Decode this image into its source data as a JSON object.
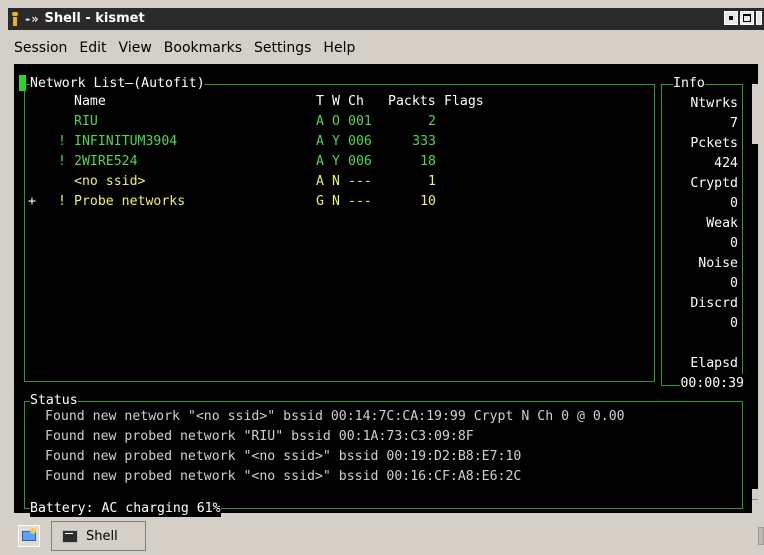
{
  "window": {
    "title": "Shell - kismet",
    "title_glyph": "-»"
  },
  "menu": [
    "Session",
    "Edit",
    "View",
    "Bookmarks",
    "Settings",
    "Help"
  ],
  "network_list": {
    "title": "Network List—(Autofit)",
    "headers": {
      "name": "Name",
      "t": "T",
      "w": "W",
      "ch": "Ch",
      "packts": "Packts",
      "flags": "Flags"
    },
    "rows": [
      {
        "marker": "",
        "bang": "",
        "name": "RIU",
        "t": "A",
        "w": "O",
        "ch": "001",
        "packts": "2",
        "color": "#4fd64f"
      },
      {
        "marker": "",
        "bang": "!",
        "name": "INFINITUM3904",
        "t": "A",
        "w": "Y",
        "ch": "006",
        "packts": "333",
        "color": "#4fd64f"
      },
      {
        "marker": "",
        "bang": "!",
        "name": "2WIRE524",
        "t": "A",
        "w": "Y",
        "ch": "006",
        "packts": "18",
        "color": "#4fd64f"
      },
      {
        "marker": "",
        "bang": "",
        "name": "<no ssid>",
        "t": "A",
        "w": "N",
        "ch": "---",
        "packts": "1",
        "color": "#f0f06a"
      },
      {
        "marker": "+",
        "bang": "!",
        "name": "Probe networks",
        "t": "G",
        "w": "N",
        "ch": "---",
        "packts": "10",
        "color": "#f0f06a"
      }
    ]
  },
  "info": {
    "title": "Info",
    "items": [
      {
        "label": "Ntwrks",
        "value": "7"
      },
      {
        "label": "Pckets",
        "value": "424"
      },
      {
        "label": "Cryptd",
        "value": "0"
      },
      {
        "label": "Weak",
        "value": "0"
      },
      {
        "label": "Noise",
        "value": "0"
      },
      {
        "label": "Discrd",
        "value": "0"
      }
    ],
    "elapsed_label": "Elapsd",
    "elapsed_value": "00:00:39"
  },
  "status": {
    "title": "Status",
    "lines": [
      "Found new network \"<no ssid>\" bssid 00:14:7C:CA:19:99 Crypt N Ch 0 @ 0.00",
      "Found new probed network \"RIU\" bssid 00:1A:73:C3:09:8F",
      "Found new probed network \"<no ssid>\" bssid 00:19:D2:B8:E7:10",
      "Found new probed network \"<no ssid>\" bssid 00:16:CF:A8:E6:2C"
    ],
    "battery": "Battery: AC charging 61%"
  },
  "taskbar": {
    "task_label": "Shell",
    "launcher_icon": "desktop-launcher-icon",
    "task_icon": "terminal-icon"
  }
}
